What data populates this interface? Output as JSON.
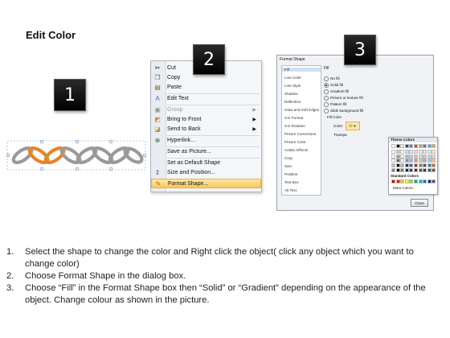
{
  "page": {
    "title": "Edit Color"
  },
  "badges": [
    "1",
    "2",
    "3"
  ],
  "colors": {
    "highlight": "#f8c95a",
    "chain_gray": "#9a9a9a",
    "chain_orange": "#e8822a",
    "badge_bg": "#111111"
  },
  "context_menu": {
    "items": [
      {
        "icon": "scissors-icon",
        "label": "Cut"
      },
      {
        "icon": "copy-icon",
        "label": "Copy"
      },
      {
        "icon": "paste-icon",
        "label": "Paste"
      },
      {
        "icon": "edit-text-icon",
        "label": "Edit Text"
      },
      {
        "icon": "group-icon",
        "label": "Group",
        "disabled": true,
        "submenu": true
      },
      {
        "icon": "bring-to-front-icon",
        "label": "Bring to Front",
        "submenu": true
      },
      {
        "icon": "send-to-back-icon",
        "label": "Send to Back",
        "submenu": true
      },
      {
        "icon": "hyperlink-icon",
        "label": "Hyperlink..."
      },
      {
        "icon": "save-picture-icon",
        "label": "Save as Picture..."
      },
      {
        "icon": "default-shape-icon",
        "label": "Set as Default Shape"
      },
      {
        "icon": "size-position-icon",
        "label": "Size and Position..."
      },
      {
        "icon": "format-shape-icon",
        "label": "Format Shape...",
        "highlighted": true
      }
    ]
  },
  "dialog": {
    "title": "Format Shape",
    "nav": [
      "Fill",
      "Line Color",
      "Line Style",
      "Shadow",
      "Reflection",
      "Glow and Soft Edges",
      "3-D Format",
      "3-D Rotation",
      "Picture Corrections",
      "Picture Color",
      "Artistic Effects",
      "Crop",
      "Size",
      "Position",
      "Text Box",
      "Alt Text"
    ],
    "selected_nav": "Fill",
    "section_title": "Fill",
    "options": [
      "No fill",
      "Solid fill",
      "Gradient fill",
      "Picture or texture fill",
      "Pattern fill",
      "Slide background fill"
    ],
    "selected_option": "Solid fill",
    "fill_color_label": "Fill Color",
    "color_label": "Color:",
    "transparency_label": "Transpa",
    "palette": {
      "theme_title": "Theme Colors",
      "standard_title": "Standard Colors",
      "more_colors": "More Colors...",
      "theme_colors": [
        "#ffffff",
        "#000000",
        "#eeece1",
        "#1f497d",
        "#4f81bd",
        "#c0504d",
        "#9bbb59",
        "#8064a2",
        "#4bacc6",
        "#f79646"
      ],
      "standard_colors": [
        "#c00000",
        "#ff0000",
        "#ffc000",
        "#ffff00",
        "#92d050",
        "#00b050",
        "#00b0f0",
        "#0070c0",
        "#002060",
        "#7030a0"
      ]
    },
    "close_label": "Close"
  },
  "instructions": [
    {
      "n": "1.",
      "text": "Select the shape to change the color and Right click the object( click any object which you want to change color)"
    },
    {
      "n": "2.",
      "text": "Choose Format Shape in the dialog box."
    },
    {
      "n": "3.",
      "text": "Choose “Fill” in the Format Shape box then “Solid” or “Gradient” depending on the appearance of the object. Change colour as shown in the picture."
    }
  ]
}
